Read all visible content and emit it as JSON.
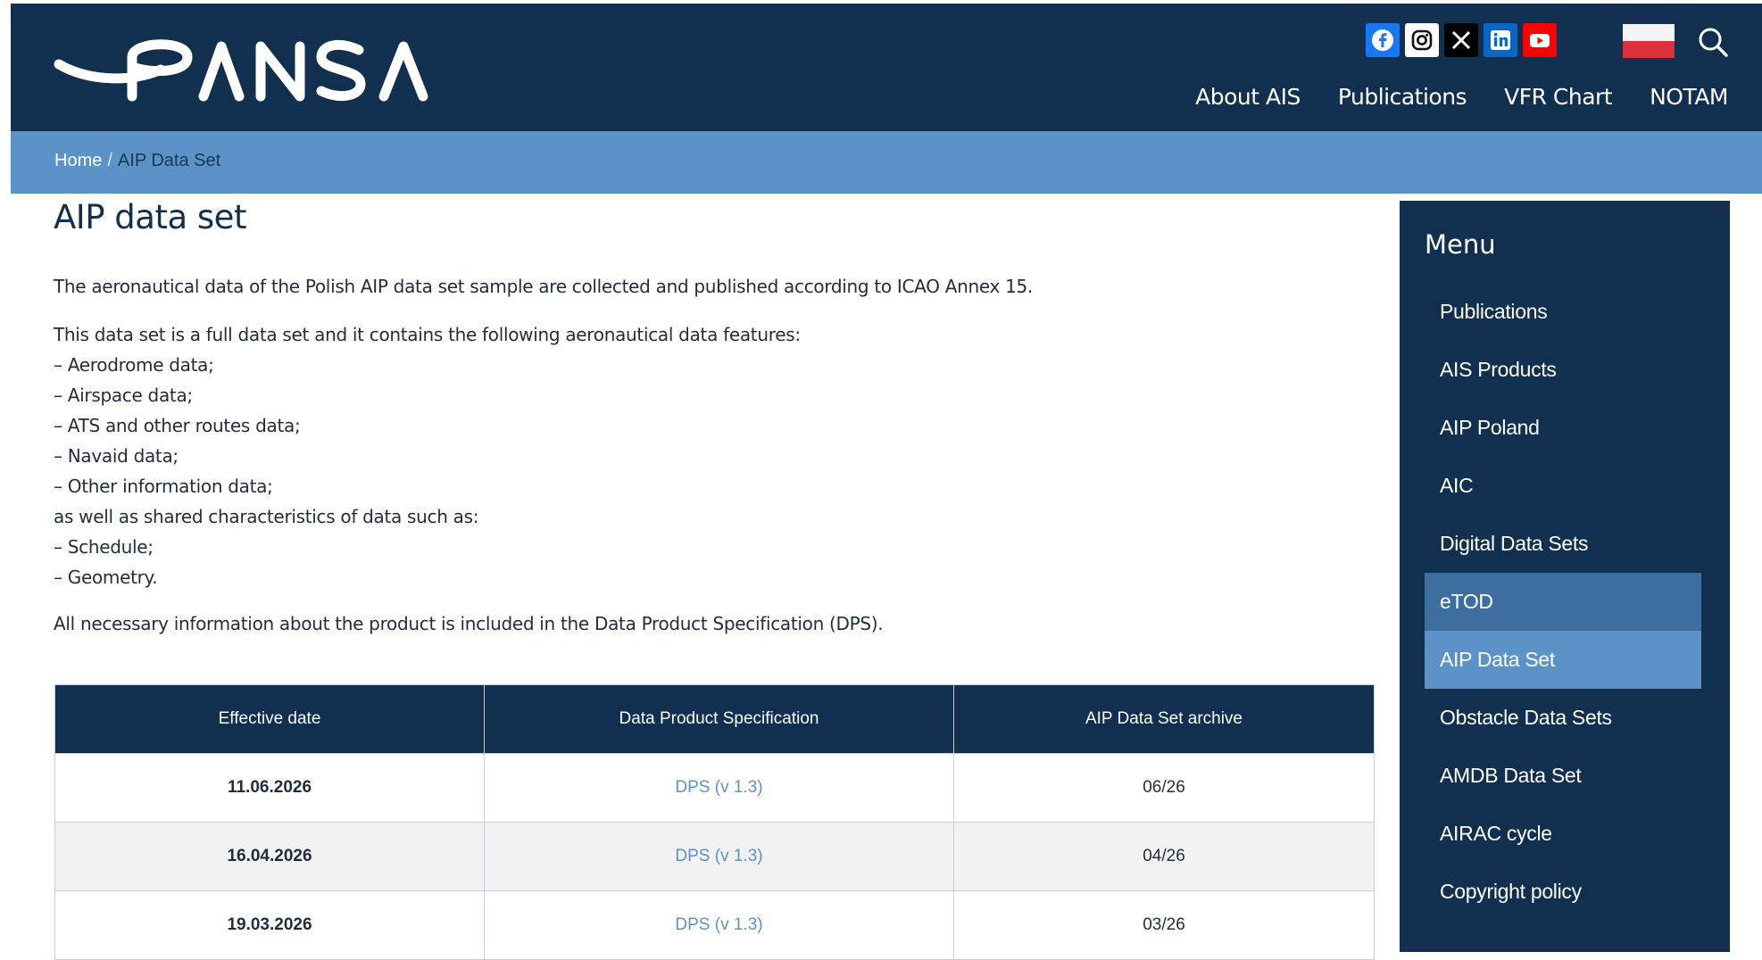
{
  "brand": {
    "logo_text": "PANSA"
  },
  "header": {
    "social": [
      {
        "name": "facebook-icon",
        "bg": "#1877f2"
      },
      {
        "name": "instagram-icon",
        "bg": "#ffffff"
      },
      {
        "name": "x-icon",
        "bg": "#000000"
      },
      {
        "name": "linkedin-icon",
        "bg": "#0a66c2"
      },
      {
        "name": "youtube-icon",
        "bg": "#ff0000"
      }
    ],
    "language_flag": "flag-pl-icon",
    "search_icon": "search-icon",
    "nav": [
      "About AIS",
      "Publications",
      "VFR Chart",
      "NOTAM"
    ]
  },
  "breadcrumb": {
    "home": "Home",
    "separator": "/",
    "current": "AIP Data Set"
  },
  "page": {
    "title": "AIP data set",
    "intro": "The aeronautical data of the Polish AIP data set sample are collected and published according to ICAO Annex 15.",
    "list_lines": [
      "This data set is a full data set and it contains the following aeronautical data features:",
      "– Aerodrome data;",
      "– Airspace data;",
      "– ATS and other routes data;",
      "– Navaid data;",
      "– Other information data;",
      "as well as shared characteristics of data such as:",
      "– Schedule;",
      "– Geometry."
    ],
    "dps_note": "All necessary information about the product is included in the Data Product Specification (DPS)."
  },
  "table": {
    "headers": [
      "Effective date",
      "Data Product Specification",
      "AIP Data Set archive"
    ],
    "rows": [
      [
        "11.06.2026",
        "DPS (v 1.3)",
        "06/26"
      ],
      [
        "16.04.2026",
        "DPS (v 1.3)",
        "04/26"
      ],
      [
        "19.03.2026",
        "DPS (v 1.3)",
        "03/26"
      ]
    ]
  },
  "sidebar": {
    "title": "Menu",
    "items": [
      {
        "label": "Publications",
        "state": ""
      },
      {
        "label": "AIS Products",
        "state": ""
      },
      {
        "label": "AIP Poland",
        "state": ""
      },
      {
        "label": "AIC",
        "state": ""
      },
      {
        "label": "Digital Data Sets",
        "state": ""
      },
      {
        "label": "eTOD",
        "state": "hover"
      },
      {
        "label": "AIP Data Set",
        "state": "active"
      },
      {
        "label": "Obstacle Data Sets",
        "state": ""
      },
      {
        "label": "AMDB Data Set",
        "state": ""
      },
      {
        "label": "AIRAC cycle",
        "state": ""
      },
      {
        "label": "Copyright policy",
        "state": ""
      }
    ]
  },
  "colors": {
    "navy": "#112f4e",
    "accent": "#5b93c9",
    "hover": "#3c6fa0"
  }
}
